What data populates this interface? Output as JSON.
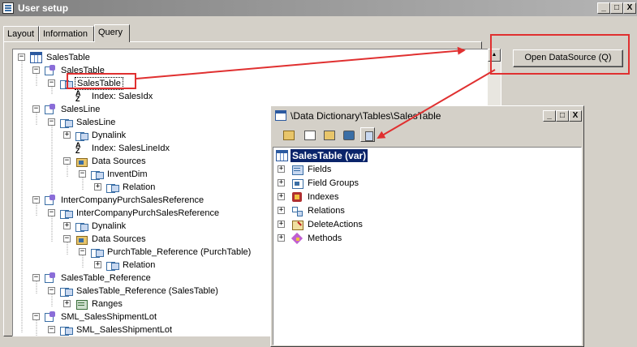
{
  "window": {
    "title": "User setup",
    "min_label": "_",
    "max_label": "□",
    "close_label": "X"
  },
  "tabs": [
    {
      "label": "Layout"
    },
    {
      "label": "Information"
    },
    {
      "label": "Query"
    }
  ],
  "buttons": {
    "open_datasource": "Open DataSource (Q)"
  },
  "query_tree": {
    "n01": "SalesTable",
    "n02": "SalesTable",
    "n03": "SalesTable",
    "n04": "Index: SalesIdx",
    "n05": "SalesLine",
    "n06": "SalesLine",
    "n07": "Dynalink",
    "n08": "Index: SalesLineIdx",
    "n09": "Data Sources",
    "n10": "InventDim",
    "n11": "Relation",
    "n12": "InterCompanyPurchSalesReference",
    "n13": "InterCompanyPurchSalesReference",
    "n14": "Dynalink",
    "n15": "Data Sources",
    "n16": "PurchTable_Reference (PurchTable)",
    "n17": "Relation",
    "n18": "SalesTable_Reference",
    "n19": "SalesTable_Reference (SalesTable)",
    "n20": "Ranges",
    "n21": "SML_SalesShipmentLot",
    "n22": "SML_SalesShipmentLot"
  },
  "child_window": {
    "title": "\\Data Dictionary\\Tables\\SalesTable",
    "tree": {
      "root": "SalesTable (var)",
      "fields": "Fields",
      "field_groups": "Field Groups",
      "indexes": "Indexes",
      "relations": "Relations",
      "delete_actions": "DeleteActions",
      "methods": "Methods"
    }
  },
  "annotation_color": "#e03030"
}
